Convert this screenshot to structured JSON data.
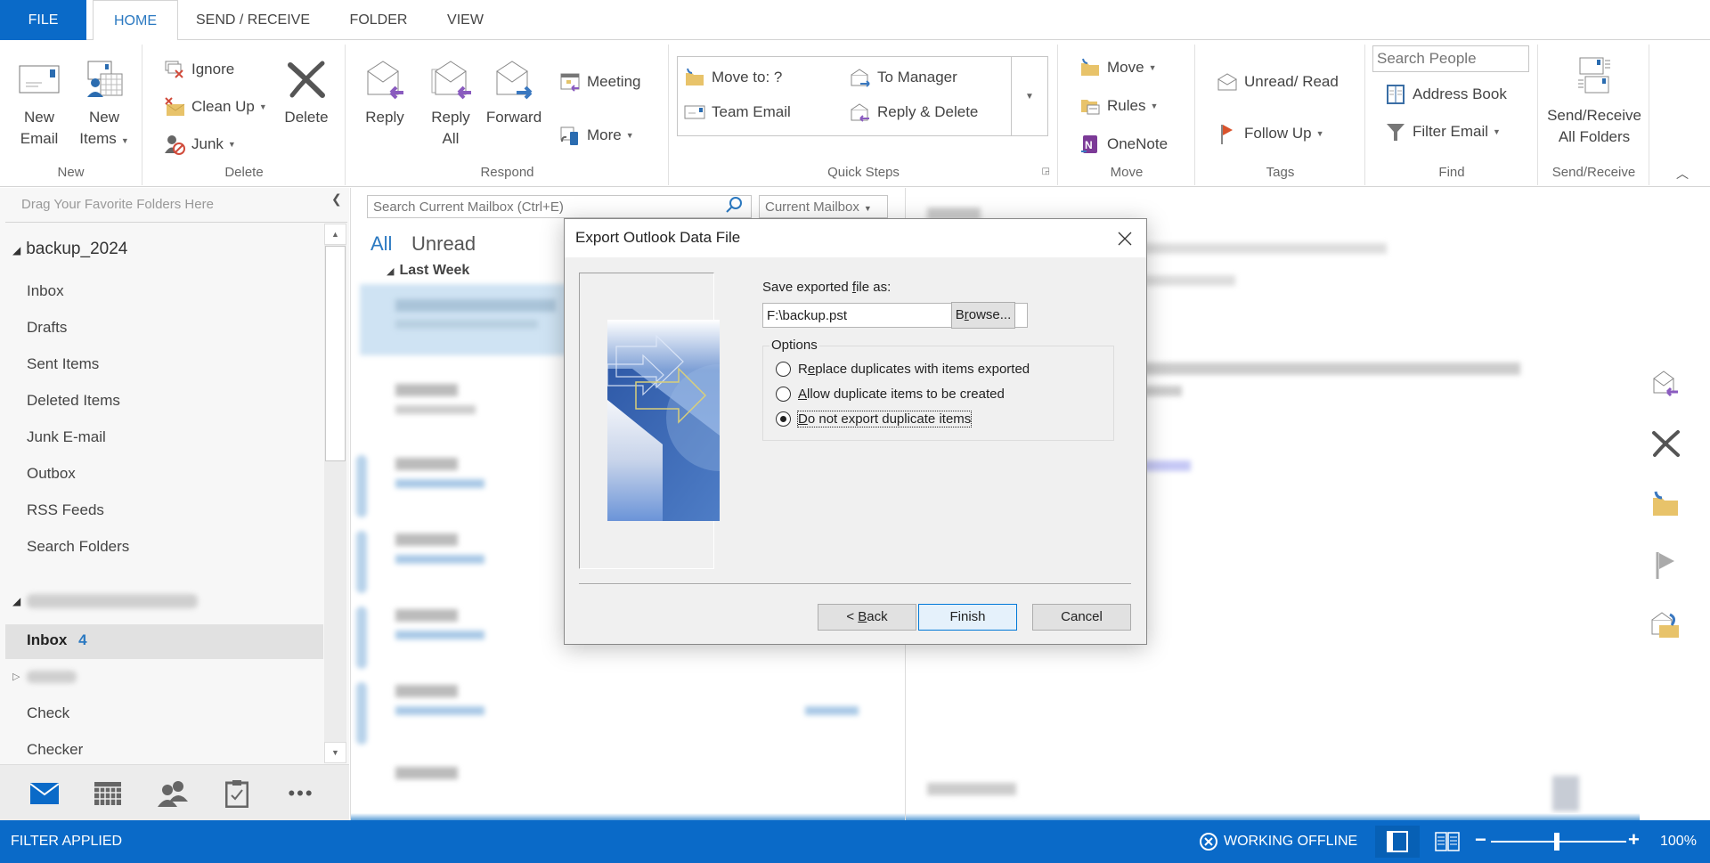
{
  "tabs": {
    "file": "FILE",
    "home": "HOME",
    "send_receive": "SEND / RECEIVE",
    "folder": "FOLDER",
    "view": "VIEW"
  },
  "ribbon": {
    "new": {
      "label": "New",
      "new_email_1": "New",
      "new_email_2": "Email",
      "new_items_1": "New",
      "new_items_2": "Items"
    },
    "delete": {
      "label": "Delete",
      "ignore": "Ignore",
      "clean_up": "Clean Up",
      "junk": "Junk",
      "delete": "Delete"
    },
    "respond": {
      "label": "Respond",
      "reply": "Reply",
      "reply_all_1": "Reply",
      "reply_all_2": "All",
      "forward": "Forward",
      "meeting": "Meeting",
      "more": "More"
    },
    "quick_steps": {
      "label": "Quick Steps",
      "move_to": "Move to: ?",
      "to_manager": "To Manager",
      "team_email": "Team Email",
      "reply_delete": "Reply & Delete"
    },
    "move": {
      "label": "Move",
      "move": "Move",
      "rules": "Rules",
      "onenote": "OneNote"
    },
    "tags": {
      "label": "Tags",
      "unread_read": "Unread/ Read",
      "follow_up": "Follow Up"
    },
    "find": {
      "label": "Find",
      "search_people_placeholder": "Search People",
      "address_book": "Address Book",
      "filter_email": "Filter Email"
    },
    "send_receive": {
      "label": "Send/Receive",
      "all_folders_1": "Send/Receive",
      "all_folders_2": "All Folders"
    }
  },
  "folder_pane": {
    "favorites_hint": "Drag Your Favorite Folders Here",
    "account1": {
      "name": "backup_2024",
      "folders": [
        "Inbox",
        "Drafts",
        "Sent Items",
        "Deleted Items",
        "Junk E-mail",
        "Outbox",
        "RSS Feeds",
        "Search Folders"
      ]
    },
    "account2": {
      "inbox_label": "Inbox",
      "inbox_unread": "4",
      "folders": [
        "Check",
        "Checker"
      ]
    }
  },
  "message_list": {
    "search_placeholder": "Search Current Mailbox (Ctrl+E)",
    "scope": "Current Mailbox",
    "filter_all": "All",
    "filter_unread": "Unread",
    "group_header": "Last Week"
  },
  "dialog": {
    "title": "Export Outlook Data File",
    "save_label_pre": "Save exported ",
    "save_label_u": "f",
    "save_label_post": "ile as:",
    "file_path": "F:\\backup.pst",
    "browse_pre": "B",
    "browse_u": "r",
    "browse_post": "owse...",
    "options_label": "Options",
    "options": [
      {
        "pre": "R",
        "u": "e",
        "post": "place duplicates with items exported",
        "checked": false
      },
      {
        "pre": "",
        "u": "A",
        "post": "llow duplicate items to be created",
        "checked": false
      },
      {
        "pre": "",
        "u": "D",
        "post": "o not export duplicate items",
        "checked": true
      }
    ],
    "back_pre": "< ",
    "back_u": "B",
    "back_post": "ack",
    "finish": "Finish",
    "cancel": "Cancel"
  },
  "statusbar": {
    "filter": "FILTER APPLIED",
    "offline": "WORKING OFFLINE",
    "zoom_level": "100%",
    "zoom_percent": 100
  },
  "colors": {
    "accent": "#0a6ac8",
    "link": "#2b79c1",
    "unread_count": "#2b79c1"
  }
}
